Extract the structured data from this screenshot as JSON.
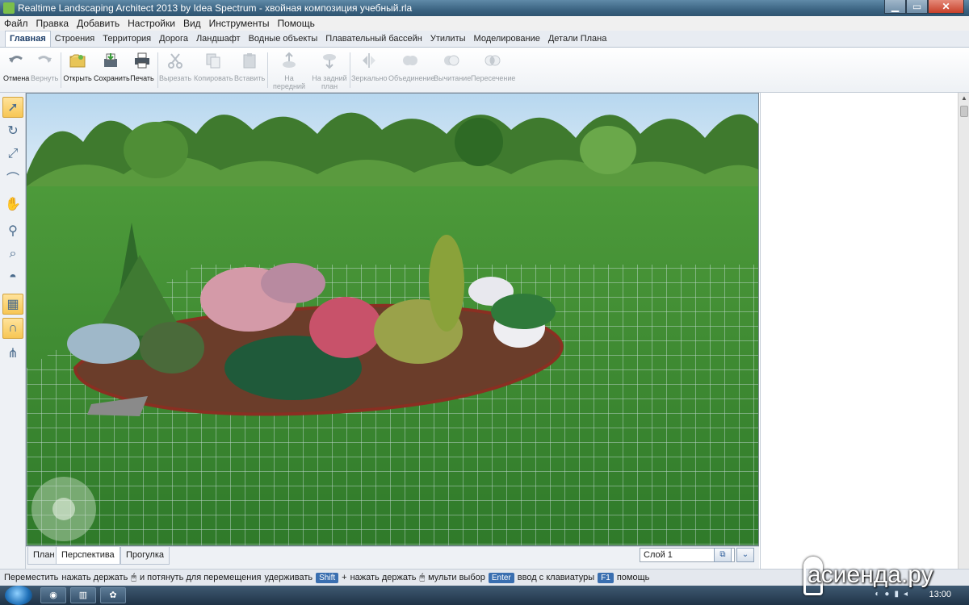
{
  "window": {
    "title": "Realtime Landscaping Architect 2013 by Idea Spectrum - хвойная композиция учебный.rla",
    "minimize": "▁",
    "maximize": "▭",
    "close": "✕"
  },
  "menu": [
    "Файл",
    "Правка",
    "Добавить",
    "Настройки",
    "Вид",
    "Инструменты",
    "Помощь"
  ],
  "ribbon_tabs": [
    "Главная",
    "Строения",
    "Территория",
    "Дорога",
    "Ландшафт",
    "Водные объекты",
    "Плавательный бассейн",
    "Утилиты",
    "Моделирование",
    "Детали Плана"
  ],
  "ribbon_active_tab": "Главная",
  "toolbar": {
    "undo": "Отмена",
    "redo": "Вернуть",
    "open": "Открыть",
    "save": "Сохранить",
    "print": "Печать",
    "cut": "Вырезать",
    "copy": "Копировать",
    "paste": "Вставить",
    "bring_front": "На передний план",
    "send_back": "На задний план",
    "mirror": "Зеркально",
    "union": "Объединение",
    "subtract": "Вычитание",
    "intersect": "Пересечение"
  },
  "left_tools": [
    "select-arrow-icon",
    "rotate-icon",
    "resize-icon",
    "curve-icon",
    "pan-hand-icon",
    "zoom-icon",
    "zoom-window-icon",
    "camera-orbit-icon",
    "grid-icon",
    "magnet-icon",
    "snap-icon"
  ],
  "view_tabs": [
    "План",
    "Перспектива",
    "Прогулка"
  ],
  "view_active_tab": "Перспектива",
  "layer": "Слой 1",
  "status": {
    "move": "Переместить",
    "press_hold": "нажать держать",
    "drag_move": "и потянуть для перемещения",
    "hold": "удерживать",
    "shift": "Shift",
    "plus": "+",
    "press_hold2": "нажать держать",
    "multi": "мульти выбор",
    "enter": "Enter",
    "keyboard": "ввод с клавиатуры",
    "f1": "F1",
    "help": "помощь"
  },
  "taskbar": {
    "time": "13:00",
    "watermark": "асиенда.ру"
  },
  "colors": {
    "sky": "#c9e1f2",
    "lawn": "#3f8a32",
    "grid": "#e8f0ff",
    "mulch": "#6b3d2a",
    "accent": "#f7c654"
  }
}
